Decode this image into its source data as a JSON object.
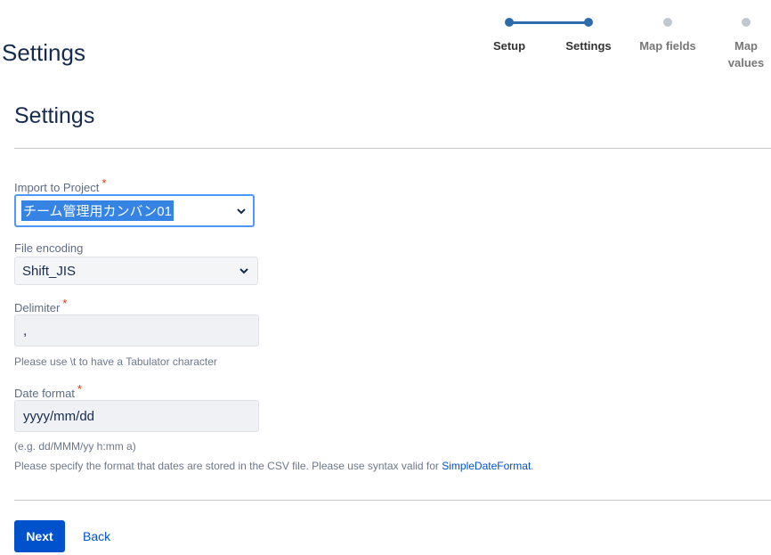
{
  "header": {
    "title": "Settings"
  },
  "progress": {
    "steps": [
      {
        "label": "Setup",
        "state": "done"
      },
      {
        "label": "Settings",
        "state": "current"
      },
      {
        "label": "Map fields",
        "state": "todo"
      },
      {
        "label": "Map values",
        "state": "todo"
      }
    ],
    "colors": {
      "done": "#2e6bab",
      "todo": "#c1c7d0"
    }
  },
  "section": {
    "title": "Settings"
  },
  "form": {
    "project": {
      "label": "Import to Project",
      "required": "*",
      "value": "チーム管理用カンバン01"
    },
    "encoding": {
      "label": "File encoding",
      "value": "Shift_JIS"
    },
    "delimiter": {
      "label": "Delimiter",
      "required": "*",
      "value": ",",
      "help": "Please use \\t to have a Tabulator character"
    },
    "date_format": {
      "label": "Date format",
      "required": "*",
      "value": "yyyy/mm/dd",
      "example": "(e.g. dd/MMM/yy h:mm a)",
      "help_prefix": "Please specify the format that dates are stored in the CSV file. Please use syntax valid for ",
      "help_link": "SimpleDateFormat",
      "help_suffix": "."
    }
  },
  "actions": {
    "next": "Next",
    "back": "Back"
  },
  "colors": {
    "primary": "#0052cc",
    "required": "#de350b",
    "focus": "#4c9aff"
  }
}
